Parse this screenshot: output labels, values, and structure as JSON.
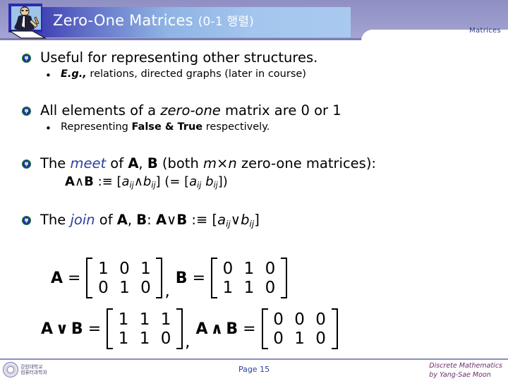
{
  "header": {
    "title_main": "Zero-One Matrices",
    "title_paren": "(0-1 행렬)",
    "right_label": "Matrices",
    "presenter_icon": "person-writing-icon",
    "band_color": "#9a9acb",
    "plate_gradient_from": "#3a3ab0",
    "plate_gradient_to": "#a9c9ef"
  },
  "content": {
    "bullets": [
      {
        "level1": "Useful for representing other structures.",
        "sub": {
          "lead": "E.g.,",
          "rest": " relations, directed graphs (later in course)"
        }
      },
      {
        "level1_a": "All elements of a ",
        "level1_em": "zero-one",
        "level1_b": " matrix are 0 or 1",
        "sub_a": "Representing ",
        "sub_false": "False",
        "sub_amp": " & ",
        "sub_true": "True",
        "sub_b": " respectively."
      },
      {
        "the": "The ",
        "term": "meet",
        "of": " of ",
        "A": "A",
        "comma": ", ",
        "B": "B",
        "tail_a": " (both ",
        "m": "m",
        "times": "×",
        "n": "n",
        "tail_b": " zero-one matrices):",
        "formula": {
          "A": "A",
          "op": "∧",
          "B": "B",
          "defines": " :≡ [",
          "a": "a",
          "aidx": "ij",
          "op2": "∧",
          "b": "b",
          "bidx": "ij",
          "close": "] (= [",
          "a2": "a",
          "a2idx": "ij",
          "space": " ",
          "b2": "b",
          "b2idx": "ij",
          "close2": "])"
        }
      },
      {
        "the": "The ",
        "term": "join",
        "of": " of ",
        "A": "A",
        "comma": ", ",
        "B": "B",
        "colon": ": ",
        "formula": {
          "A": "A",
          "op": "∨",
          "B": "B",
          "defines": " :≡ [",
          "a": "a",
          "aidx": "ij",
          "op2": "∨",
          "b": "b",
          "bidx": "ij",
          "close": "]"
        }
      }
    ],
    "accent_color": "#2b3f9e"
  },
  "matrices": {
    "row1": [
      {
        "label": "A",
        "op": "",
        "eq": "=",
        "values": [
          [
            "1",
            "0",
            "1"
          ],
          [
            "0",
            "1",
            "0"
          ]
        ]
      },
      {
        "label": "B",
        "op": "",
        "eq": "=",
        "values": [
          [
            "0",
            "1",
            "0"
          ],
          [
            "1",
            "1",
            "0"
          ]
        ]
      }
    ],
    "row2": [
      {
        "label": "A",
        "op": "∨",
        "label2": "B",
        "eq": "=",
        "values": [
          [
            "1",
            "1",
            "1"
          ],
          [
            "1",
            "1",
            "0"
          ]
        ]
      },
      {
        "label": "A",
        "op": "∧",
        "label2": "B",
        "eq": "=",
        "values": [
          [
            "0",
            "0",
            "0"
          ],
          [
            "0",
            "1",
            "0"
          ]
        ]
      }
    ],
    "separator": ","
  },
  "footer": {
    "page": "Page 15",
    "course_line1": "Discrete Mathematics",
    "course_line2": "by Yang-Sae Moon",
    "logo_text_line1": "강원대학교",
    "logo_text_line2": "컴퓨터과학과",
    "logo_icon": "university-seal-icon",
    "rule_color": "#8c8cc0"
  }
}
